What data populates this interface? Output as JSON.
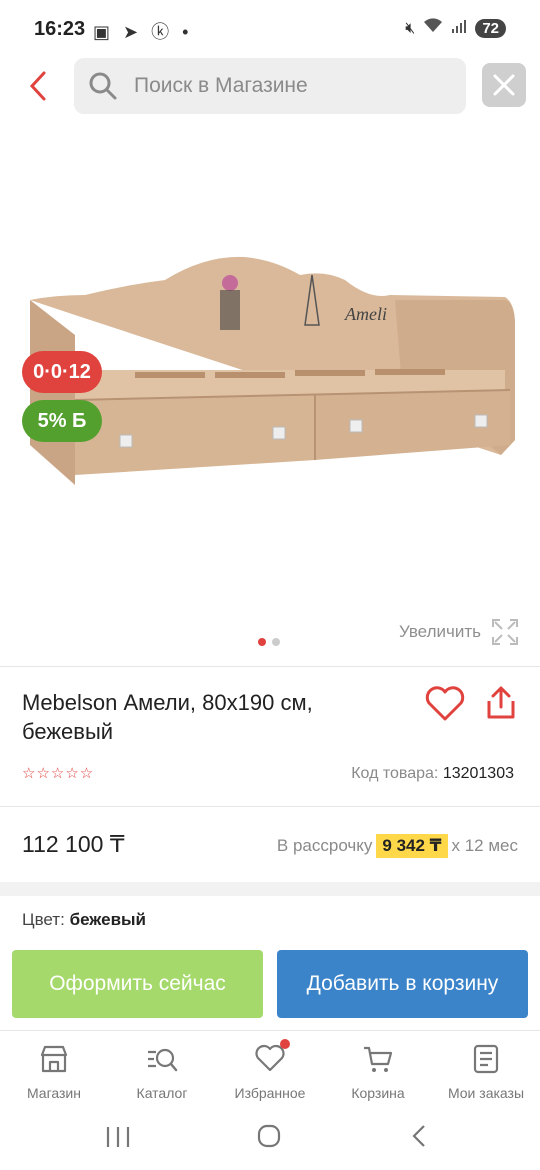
{
  "status_bar": {
    "time": "16:23",
    "left_icons": [
      "screenshot-icon",
      "telegram-icon",
      "kaspi-icon",
      "dot"
    ],
    "right_icons": [
      "mute-icon",
      "wifi-icon",
      "signal-icon"
    ],
    "battery": "72"
  },
  "header": {
    "search_placeholder": "Поиск в Магазине",
    "back_icon": "chevron-left-icon",
    "close_icon": "close-icon"
  },
  "gallery": {
    "badges": [
      "0·0·12",
      "5% Б"
    ],
    "zoom_label": "Увеличить",
    "slides": 2,
    "active_slide": 1,
    "product_text_on_image": "Ameli"
  },
  "product": {
    "title": "Mebelson Амели, 80x190 см, бежевый",
    "stars": "☆☆☆☆☆",
    "sku_label": "Код товара:",
    "sku_value": "13201303",
    "price": "112 100 ₸",
    "installment_label": "В рассрочку",
    "installment_amount": "9 342 ₸",
    "installment_term": "x 12 мес",
    "color_label": "Цвет:",
    "color_value": "бежевый"
  },
  "actions": {
    "buy_now": "Оформить сейчас",
    "add_to_cart": "Добавить в корзину"
  },
  "bottom_nav": [
    {
      "label": "Магазин",
      "icon": "shop-icon"
    },
    {
      "label": "Каталог",
      "icon": "catalog-search-icon"
    },
    {
      "label": "Избранное",
      "icon": "heart-icon"
    },
    {
      "label": "Корзина",
      "icon": "cart-icon"
    },
    {
      "label": "Мои заказы",
      "icon": "orders-icon"
    }
  ],
  "colors": {
    "accent_red": "#e0423d",
    "badge_green": "#54a02f",
    "buy_green": "#a6d96c",
    "cart_blue": "#3b84c9",
    "highlight_yellow": "#ffd84a"
  }
}
